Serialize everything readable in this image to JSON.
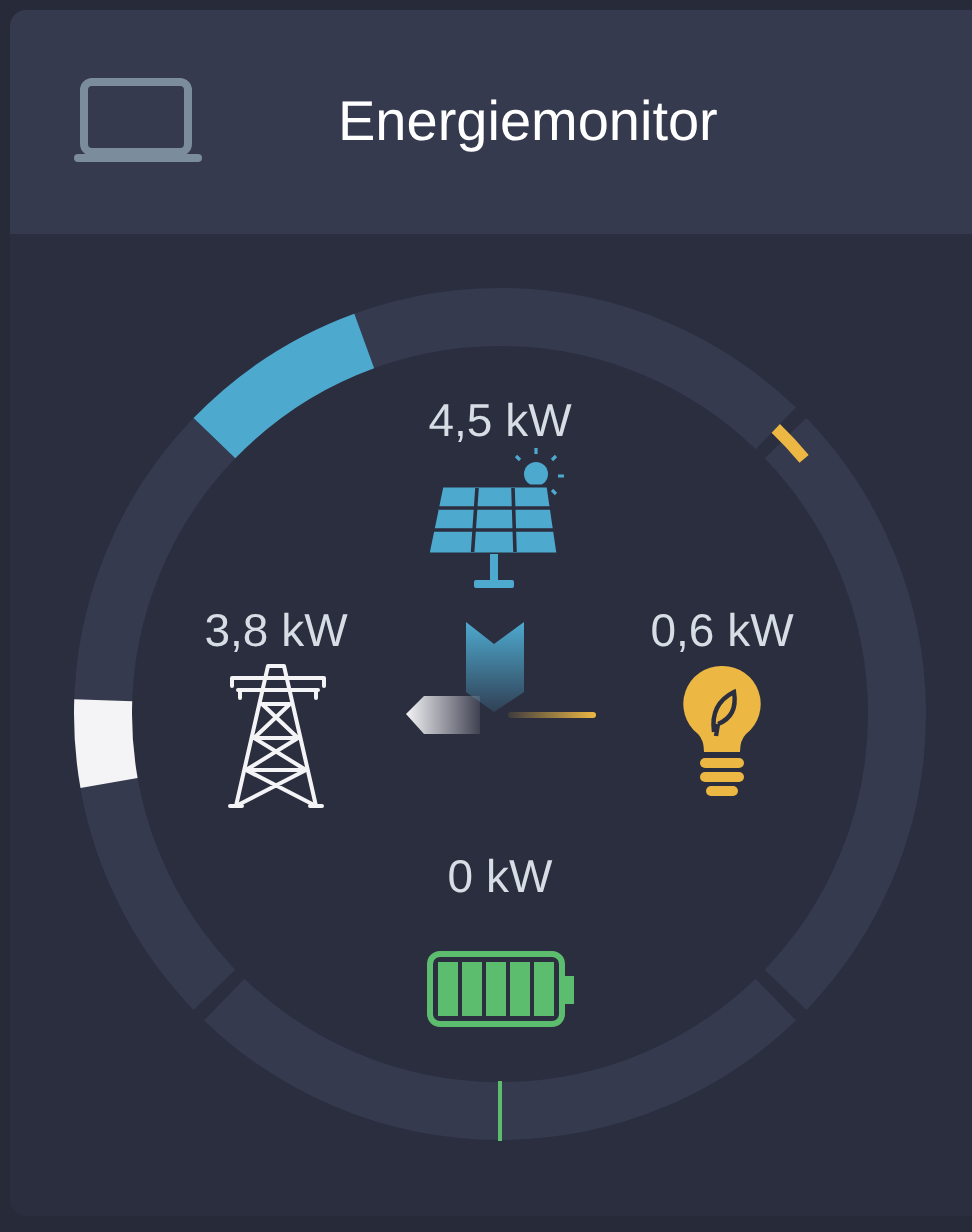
{
  "header": {
    "title": "Energiemonitor"
  },
  "nodes": [
    {
      "kind": "solar",
      "value": "4,5 kW",
      "color": "#4ea9cf"
    },
    {
      "kind": "grid",
      "value": "3,8 kW",
      "color": "#f4f4f6"
    },
    {
      "kind": "consumption",
      "value": "0,6 kW",
      "color": "#ecb843"
    },
    {
      "kind": "battery",
      "value": "0 kW",
      "color": "#5cbd6f"
    }
  ]
}
